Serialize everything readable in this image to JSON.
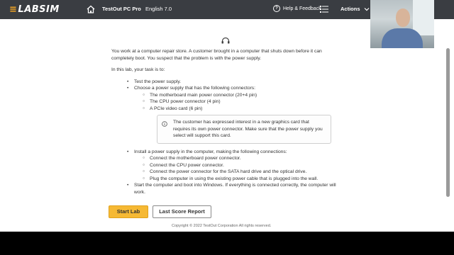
{
  "header": {
    "logo_text": "LABSIM",
    "product_name": "TestOut PC Pro",
    "language": "English 7.0",
    "help_label": "Help & Feedback",
    "actions_label": "Actions",
    "icons": [
      "home-icon",
      "help-icon",
      "menu-icon",
      "chevron-down-icon"
    ]
  },
  "intro": {
    "scenario": "You work at a computer repair store. A customer brought in a computer that shuts down before it can completely boot. You suspect that the problem is with the power supply.",
    "task_heading": "In this lab, your task is to:"
  },
  "tasks": [
    {
      "text": "Test the power supply."
    },
    {
      "text": "Choose a power supply that has the following connectors:",
      "subitems": [
        "The motherboard main power connector (20+4 pin)",
        "The CPU power connector (4 pin)",
        "A PCIe video card (6 pin)"
      ]
    },
    {
      "text": "Install a power supply in the computer, making the following connections:",
      "subitems": [
        "Connect the motherboard power connector.",
        "Connect the CPU power connector.",
        "Connect the power connector for the SATA hard drive and the optical drive.",
        "Plug the computer in using the existing power cable that is plugged into the wall."
      ]
    },
    {
      "text": "Start the computer and boot into Windows. If everything is connected correctly, the computer will work."
    }
  ],
  "note": "The customer has expressed interest in a new graphics card that requires its own power connector. Make sure that the power supply you select will support this card.",
  "buttons": {
    "start": "Start Lab",
    "score": "Last Score Report"
  },
  "footer": {
    "copyright": "Copyright © 2022 TestOut Corporation  All rights reserved."
  },
  "colors": {
    "topbar": "#3a3d42",
    "accent": "#f6b934",
    "bottom": "#000000"
  }
}
